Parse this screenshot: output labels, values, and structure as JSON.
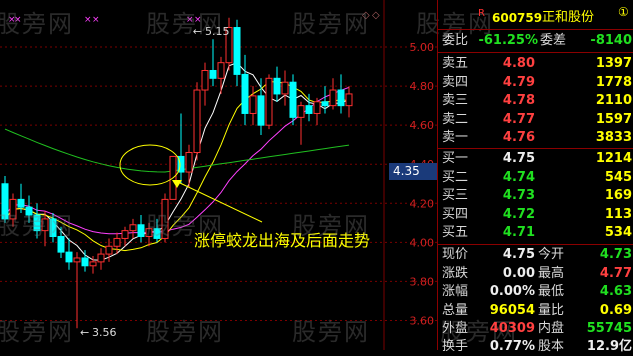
{
  "watermark": "股旁网",
  "header": {
    "flag": "R",
    "code": "600759",
    "name": "正和股份",
    "badge": "①"
  },
  "chart_data": {
    "type": "candlestick",
    "y_axis_ticks": [
      "5.00",
      "4.80",
      "4.60",
      "4.40",
      "4.20",
      "4.00",
      "3.80",
      "3.60"
    ],
    "current_price_tag": "4.35",
    "high_marker": "5.15",
    "low_marker": "3.56",
    "annotation": "涨停蛟龙出海及后面走势",
    "candles": [
      {
        "o": 4.3,
        "h": 4.34,
        "l": 4.1,
        "c": 4.12
      },
      {
        "o": 4.12,
        "h": 4.25,
        "l": 4.08,
        "c": 4.22
      },
      {
        "o": 4.22,
        "h": 4.3,
        "l": 4.15,
        "c": 4.18
      },
      {
        "o": 4.18,
        "h": 4.24,
        "l": 4.1,
        "c": 4.14
      },
      {
        "o": 4.14,
        "h": 4.2,
        "l": 4.02,
        "c": 4.06
      },
      {
        "o": 4.06,
        "h": 4.16,
        "l": 3.98,
        "c": 4.12
      },
      {
        "o": 4.12,
        "h": 4.15,
        "l": 4.0,
        "c": 4.03
      },
      {
        "o": 4.03,
        "h": 4.08,
        "l": 3.92,
        "c": 3.95
      },
      {
        "o": 3.95,
        "h": 4.02,
        "l": 3.86,
        "c": 3.9
      },
      {
        "o": 3.9,
        "h": 3.95,
        "l": 3.56,
        "c": 3.92
      },
      {
        "o": 3.92,
        "h": 3.96,
        "l": 3.85,
        "c": 3.88
      },
      {
        "o": 3.88,
        "h": 3.93,
        "l": 3.84,
        "c": 3.9
      },
      {
        "o": 3.9,
        "h": 3.97,
        "l": 3.86,
        "c": 3.94
      },
      {
        "o": 3.94,
        "h": 4.02,
        "l": 3.9,
        "c": 3.98
      },
      {
        "o": 3.98,
        "h": 4.05,
        "l": 3.94,
        "c": 4.02
      },
      {
        "o": 4.02,
        "h": 4.08,
        "l": 3.98,
        "c": 4.06
      },
      {
        "o": 4.06,
        "h": 4.12,
        "l": 4.02,
        "c": 4.09
      },
      {
        "o": 4.09,
        "h": 4.14,
        "l": 4.0,
        "c": 4.03
      },
      {
        "o": 4.03,
        "h": 4.1,
        "l": 3.98,
        "c": 4.07
      },
      {
        "o": 4.07,
        "h": 4.12,
        "l": 4.0,
        "c": 4.02
      },
      {
        "o": 4.02,
        "h": 4.25,
        "l": 4.0,
        "c": 4.22
      },
      {
        "o": 4.22,
        "h": 4.44,
        "l": 4.22,
        "c": 4.44
      },
      {
        "o": 4.44,
        "h": 4.66,
        "l": 4.3,
        "c": 4.36
      },
      {
        "o": 4.36,
        "h": 4.5,
        "l": 4.28,
        "c": 4.46
      },
      {
        "o": 4.46,
        "h": 4.82,
        "l": 4.42,
        "c": 4.78
      },
      {
        "o": 4.78,
        "h": 4.92,
        "l": 4.7,
        "c": 4.88
      },
      {
        "o": 4.88,
        "h": 5.04,
        "l": 4.8,
        "c": 4.84
      },
      {
        "o": 4.84,
        "h": 4.95,
        "l": 4.76,
        "c": 4.92
      },
      {
        "o": 4.92,
        "h": 5.15,
        "l": 4.88,
        "c": 5.1
      },
      {
        "o": 5.1,
        "h": 5.14,
        "l": 4.8,
        "c": 4.86
      },
      {
        "o": 4.86,
        "h": 4.96,
        "l": 4.6,
        "c": 4.66
      },
      {
        "o": 4.66,
        "h": 4.8,
        "l": 4.6,
        "c": 4.75
      },
      {
        "o": 4.75,
        "h": 4.84,
        "l": 4.55,
        "c": 4.6
      },
      {
        "o": 4.6,
        "h": 4.86,
        "l": 4.58,
        "c": 4.84
      },
      {
        "o": 4.84,
        "h": 4.9,
        "l": 4.72,
        "c": 4.76
      },
      {
        "o": 4.76,
        "h": 4.88,
        "l": 4.7,
        "c": 4.82
      },
      {
        "o": 4.82,
        "h": 4.86,
        "l": 4.6,
        "c": 4.64
      },
      {
        "o": 4.64,
        "h": 4.72,
        "l": 4.5,
        "c": 4.7
      },
      {
        "o": 4.7,
        "h": 4.76,
        "l": 4.62,
        "c": 4.66
      },
      {
        "o": 4.66,
        "h": 4.74,
        "l": 4.6,
        "c": 4.72
      },
      {
        "o": 4.72,
        "h": 4.8,
        "l": 4.66,
        "c": 4.7
      },
      {
        "o": 4.7,
        "h": 4.84,
        "l": 4.68,
        "c": 4.78
      },
      {
        "o": 4.78,
        "h": 4.86,
        "l": 4.66,
        "c": 4.7
      },
      {
        "o": 4.7,
        "h": 4.8,
        "l": 4.64,
        "c": 4.76
      }
    ],
    "ma_colors": {
      "ma5": "#ffffff",
      "ma10": "#ffff00",
      "ma20": "#ff40ff",
      "ma60": "#20c020"
    },
    "up_color": "#ff3030",
    "down_color": "#00ffff"
  },
  "panel": {
    "weibi": {
      "label": "委比",
      "value": "-61.25%",
      "label2": "委差",
      "value2": "-8140"
    },
    "asks": [
      {
        "label": "卖五",
        "price": "4.80",
        "vol": "1397"
      },
      {
        "label": "卖四",
        "price": "4.79",
        "vol": "1778"
      },
      {
        "label": "卖三",
        "price": "4.78",
        "vol": "2110"
      },
      {
        "label": "卖二",
        "price": "4.77",
        "vol": "1597"
      },
      {
        "label": "卖一",
        "price": "4.76",
        "vol": "3833"
      }
    ],
    "bids": [
      {
        "label": "买一",
        "price": "4.75",
        "vol": "1214",
        "pc": "white"
      },
      {
        "label": "买二",
        "price": "4.74",
        "vol": "545",
        "pc": "green"
      },
      {
        "label": "买三",
        "price": "4.73",
        "vol": "169",
        "pc": "green"
      },
      {
        "label": "买四",
        "price": "4.72",
        "vol": "113",
        "pc": "green"
      },
      {
        "label": "买五",
        "price": "4.71",
        "vol": "534",
        "pc": "green"
      }
    ],
    "stats": [
      {
        "l1": "现价",
        "v1": "4.75",
        "c1": "white",
        "l2": "今开",
        "v2": "4.73",
        "c2": "green"
      },
      {
        "l1": "涨跌",
        "v1": "0.00",
        "c1": "white",
        "l2": "最高",
        "v2": "4.77",
        "c2": "red"
      },
      {
        "l1": "涨幅",
        "v1": "0.00%",
        "c1": "white",
        "l2": "最低",
        "v2": "4.63",
        "c2": "green"
      },
      {
        "l1": "总量",
        "v1": "96054",
        "c1": "yellow",
        "l2": "量比",
        "v2": "0.69",
        "c2": "yellow"
      },
      {
        "l1": "外盘",
        "v1": "40309",
        "c1": "red",
        "l2": "内盘",
        "v2": "55745",
        "c2": "green"
      }
    ],
    "cut": {
      "l1": "换手",
      "v1": "0.77%",
      "l2": "股本",
      "v2": "12.9亿"
    }
  }
}
